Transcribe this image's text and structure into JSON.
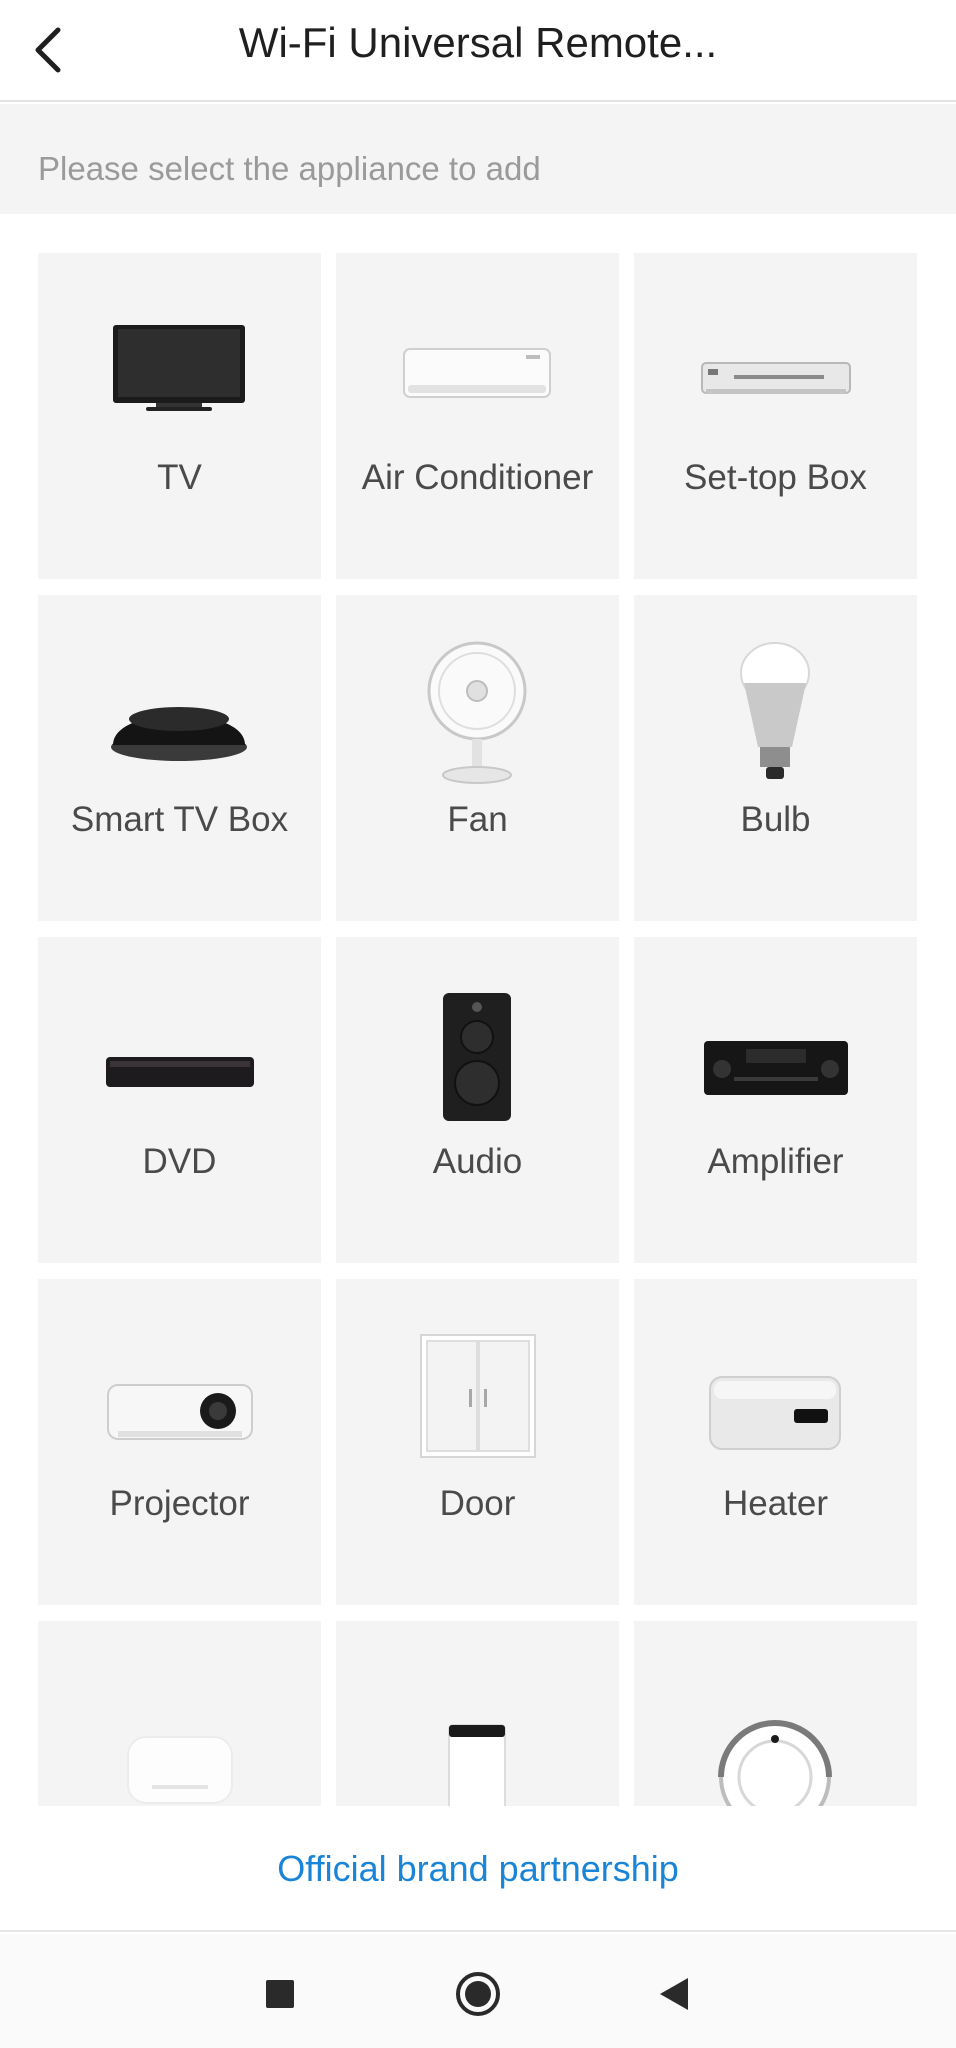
{
  "header": {
    "title": "Wi-Fi Universal Remote..."
  },
  "subheader": {
    "text": "Please select the appliance to add"
  },
  "appliances": [
    {
      "label": "TV",
      "icon": "tv-icon"
    },
    {
      "label": "Air Conditioner",
      "icon": "air-conditioner-icon"
    },
    {
      "label": "Set-top Box",
      "icon": "set-top-box-icon"
    },
    {
      "label": "Smart TV Box",
      "icon": "smart-tv-box-icon"
    },
    {
      "label": "Fan",
      "icon": "fan-icon"
    },
    {
      "label": "Bulb",
      "icon": "bulb-icon"
    },
    {
      "label": "DVD",
      "icon": "dvd-icon"
    },
    {
      "label": "Audio",
      "icon": "audio-icon"
    },
    {
      "label": "Amplifier",
      "icon": "amplifier-icon"
    },
    {
      "label": "Projector",
      "icon": "projector-icon"
    },
    {
      "label": "Door",
      "icon": "door-icon"
    },
    {
      "label": "Heater",
      "icon": "heater-icon"
    },
    {
      "label": "",
      "icon": "humidifier-icon"
    },
    {
      "label": "",
      "icon": "air-purifier-icon"
    },
    {
      "label": "",
      "icon": "robot-vacuum-icon"
    }
  ],
  "footer": {
    "partner_link": "Official brand partnership"
  },
  "navbar": {
    "recent": "square-icon",
    "home": "circle-icon",
    "back": "triangle-back-icon"
  }
}
